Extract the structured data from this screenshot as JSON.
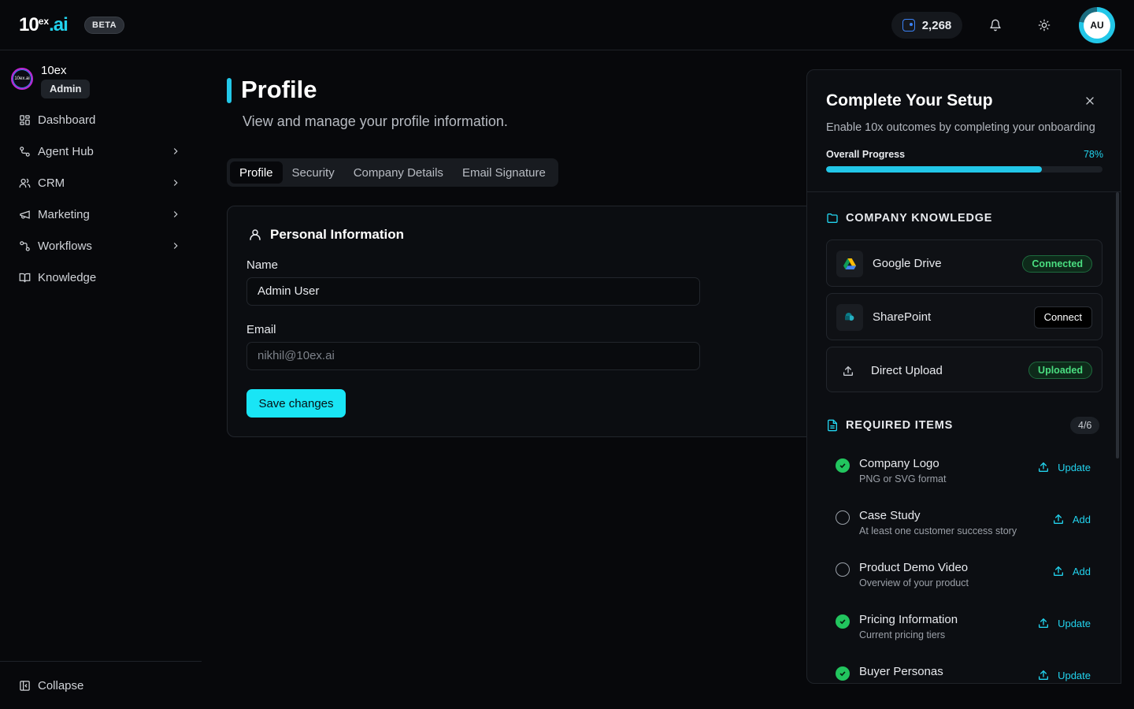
{
  "header": {
    "logo_main": "10",
    "logo_sup": "ex",
    "logo_ai": ".ai",
    "beta": "BETA",
    "credits": "2,268",
    "avatar_initials": "AU",
    "setup_progress": 0.78
  },
  "sidebar": {
    "org_logo_text": "10ex.ai",
    "org_name": "10ex",
    "org_role": "Admin",
    "items": [
      {
        "label": "Dashboard",
        "icon": "dashboard-icon"
      },
      {
        "label": "Agent Hub",
        "icon": "agent-hub-icon"
      },
      {
        "label": "CRM",
        "icon": "users-icon"
      },
      {
        "label": "Marketing",
        "icon": "megaphone-icon"
      },
      {
        "label": "Workflows",
        "icon": "workflow-icon"
      },
      {
        "label": "Knowledge",
        "icon": "book-icon"
      }
    ],
    "collapse_label": "Collapse"
  },
  "page": {
    "title": "Profile",
    "subtitle": "View and manage your profile information.",
    "tabs": [
      "Profile",
      "Security",
      "Company Details",
      "Email Signature"
    ],
    "active_tab": "Profile"
  },
  "personal_info": {
    "title": "Personal Information",
    "name_label": "Name",
    "name_value": "Admin User",
    "email_label": "Email",
    "email_value": "nikhil@10ex.ai",
    "save_label": "Save changes"
  },
  "setup_panel": {
    "title": "Complete Your Setup",
    "subtitle": "Enable 10x outcomes by completing your onboarding",
    "progress_label": "Overall Progress",
    "progress_value": "78%",
    "progress_fraction": 0.78,
    "knowledge_heading": "COMPANY KNOWLEDGE",
    "sources": [
      {
        "name": "Google Drive",
        "status": "Connected"
      },
      {
        "name": "SharePoint",
        "action": "Connect"
      },
      {
        "name": "Direct Upload",
        "status": "Uploaded"
      }
    ],
    "required_heading": "REQUIRED ITEMS",
    "required_count": "4/6",
    "required_items": [
      {
        "name": "Company Logo",
        "desc": "PNG or SVG format",
        "done": true,
        "action": "Update"
      },
      {
        "name": "Case Study",
        "desc": "At least one customer success story",
        "done": false,
        "action": "Add"
      },
      {
        "name": "Product Demo Video",
        "desc": "Overview of your product",
        "done": false,
        "action": "Add"
      },
      {
        "name": "Pricing Information",
        "desc": "Current pricing tiers",
        "done": true,
        "action": "Update"
      },
      {
        "name": "Buyer Personas",
        "desc": "",
        "done": true,
        "action": "Update"
      }
    ]
  },
  "colors": {
    "accent": "#22c7e8",
    "success": "#22c55e",
    "background": "#07080b"
  }
}
